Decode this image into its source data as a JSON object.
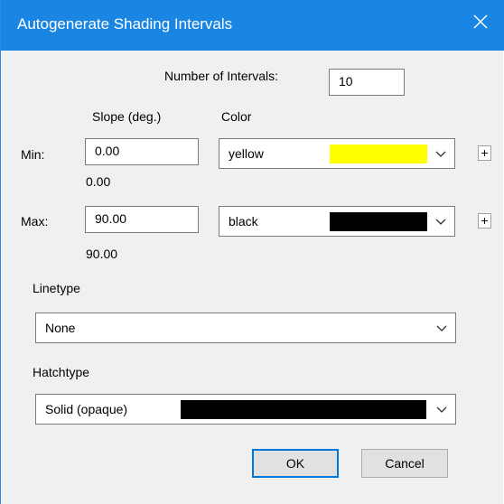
{
  "window": {
    "title": "Autogenerate Shading Intervals"
  },
  "intervals": {
    "label": "Number of Intervals:",
    "value": "10"
  },
  "columns": {
    "slope": "Slope (deg.)",
    "color": "Color"
  },
  "min": {
    "label": "Min:",
    "slope_value": "0.00",
    "slope_display": "0.00",
    "color_name": "yellow",
    "color_hex": "#ffff00"
  },
  "max": {
    "label": "Max:",
    "slope_value": "90.00",
    "slope_display": "90.00",
    "color_name": "black",
    "color_hex": "#000000"
  },
  "linetype": {
    "label": "Linetype",
    "value": "None"
  },
  "hatchtype": {
    "label": "Hatchtype",
    "value": "Solid (opaque)",
    "color_hex": "#000000"
  },
  "buttons": {
    "ok": "OK",
    "cancel": "Cancel",
    "plus": "+"
  },
  "colors": {
    "titlebar": "#1a85e3",
    "dialog_bg": "#f0f0f0",
    "accent": "#0078d7"
  }
}
